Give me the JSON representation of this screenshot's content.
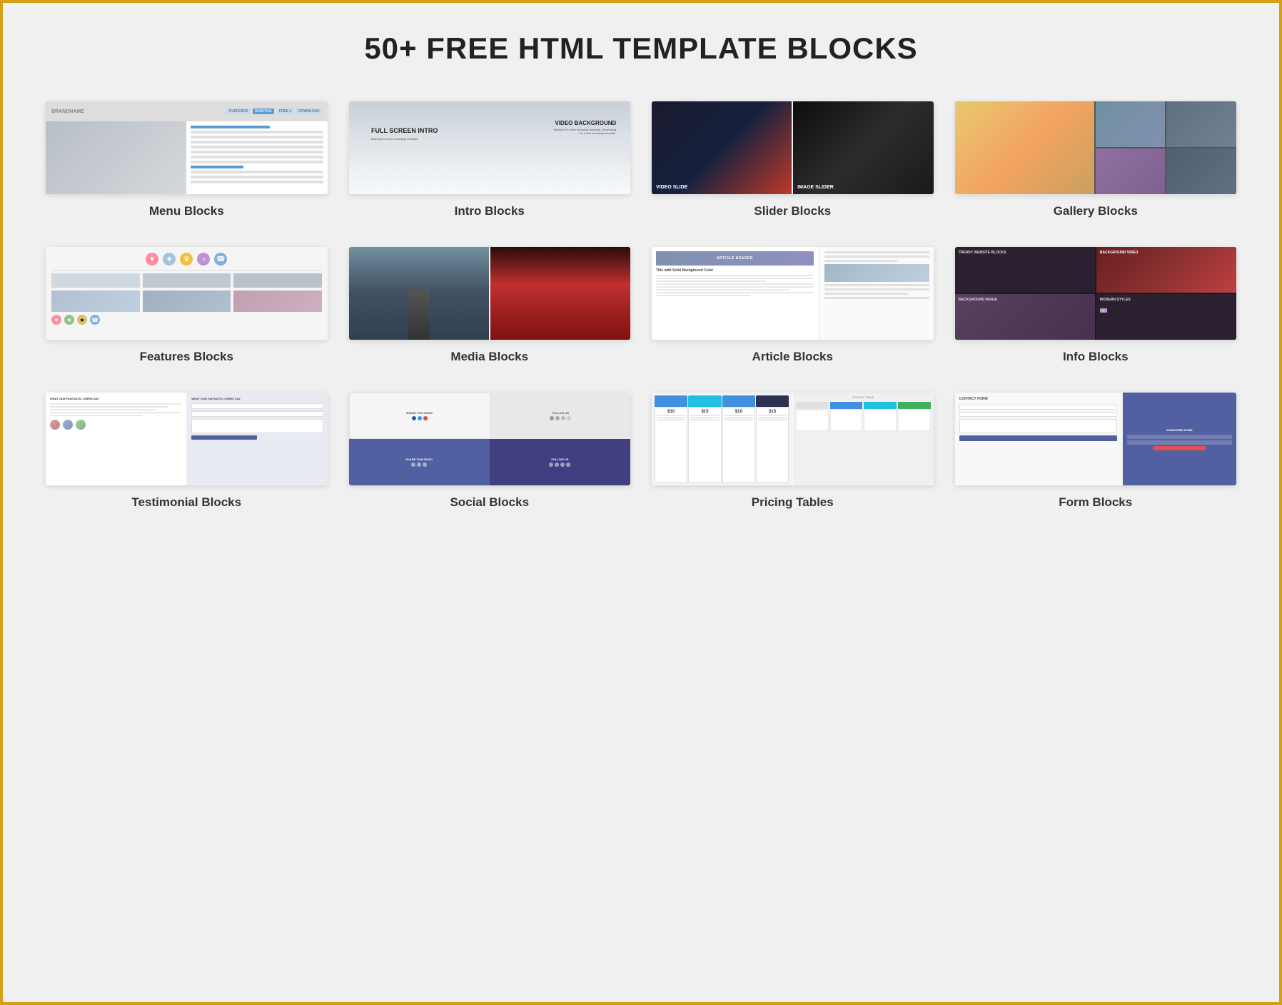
{
  "page": {
    "title": "50+ FREE HTML TEMPLATE BLOCKS",
    "border_color": "#d4a017"
  },
  "blocks": [
    {
      "id": "menu",
      "label": "Menu Blocks",
      "thumb_type": "menu"
    },
    {
      "id": "intro",
      "label": "Intro Blocks",
      "thumb_type": "intro",
      "content": {
        "left_title": "FULL SCREEN INTRO",
        "right_title": "VIDEO BACKGROUND",
        "right_sub": "Making it is a free bootstrap template. Developing it is a free bootstrap template."
      }
    },
    {
      "id": "slider",
      "label": "Slider Blocks",
      "thumb_type": "slider",
      "content": {
        "video_label": "VIDEO SLIDE",
        "image_label": "IMAGE SLIDER"
      }
    },
    {
      "id": "gallery",
      "label": "Gallery Blocks",
      "thumb_type": "gallery"
    },
    {
      "id": "features",
      "label": "Features Blocks",
      "thumb_type": "features"
    },
    {
      "id": "media",
      "label": "Media Blocks",
      "thumb_type": "media"
    },
    {
      "id": "article",
      "label": "Article Blocks",
      "thumb_type": "article",
      "content": {
        "header": "ARTICLE HEADER",
        "subtitle": "Title with Solid Background Color"
      }
    },
    {
      "id": "info",
      "label": "Info Blocks",
      "thumb_type": "info",
      "content": {
        "tl": "TRENDY WEBSITE BLOCKS",
        "tr": "BACKGROUND VIDEO",
        "bl": "BACKGROUND IMAGE",
        "br": "MODERN STYLES"
      }
    },
    {
      "id": "testimonial",
      "label": "Testimonial Blocks",
      "thumb_type": "testimonial",
      "content": {
        "title": "WHAT OUR FANTASTIC USERS SAY"
      }
    },
    {
      "id": "social",
      "label": "Social Blocks",
      "thumb_type": "social",
      "content": {
        "share_light": "SHARE THIS PAGE!",
        "follow_light": "FOLLOW US",
        "share_dark": "SHARE THIS PAGE!",
        "follow_dark": "FOLLOW US"
      }
    },
    {
      "id": "pricing",
      "label": "Pricing Tables",
      "thumb_type": "pricing",
      "content": {
        "title": "PRICING TABLE",
        "plans": [
          "$10",
          "$15",
          "$10",
          "$15"
        ]
      }
    },
    {
      "id": "form",
      "label": "Form Blocks",
      "thumb_type": "form",
      "content": {
        "contact_title": "CONTACT FORM",
        "subscribe_title": "SUBSCRIBE FORM"
      }
    }
  ]
}
